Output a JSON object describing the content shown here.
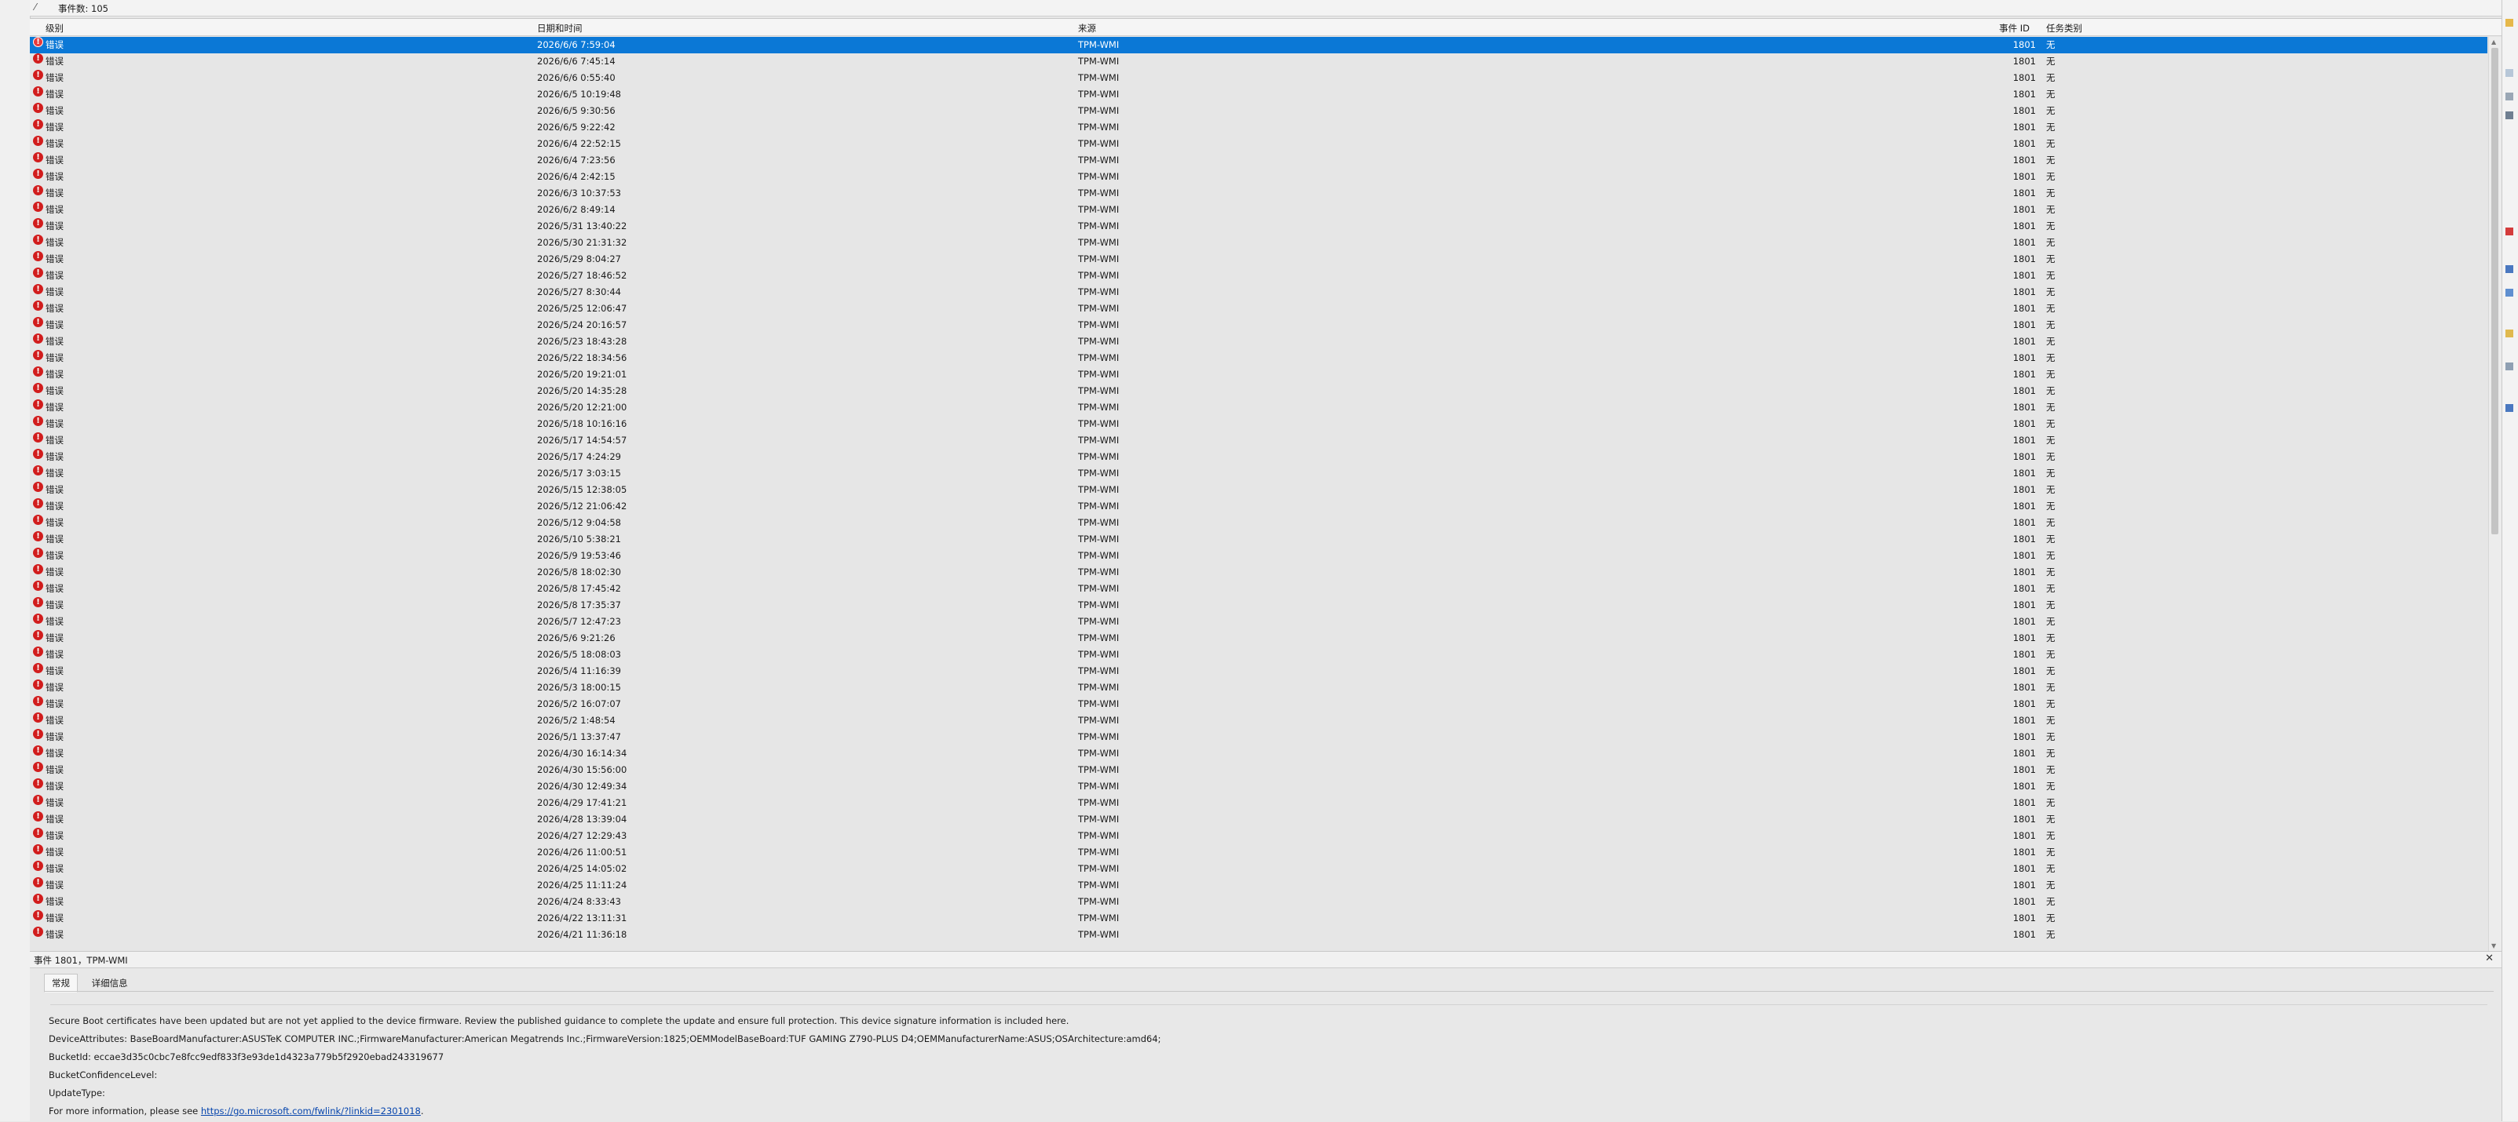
{
  "summary": {
    "label": "事件数: 105"
  },
  "columns": {
    "level": "级别",
    "date": "日期和时间",
    "source": "来源",
    "id": "事件 ID",
    "category": "任务类别"
  },
  "rows": [
    {
      "level": "错误",
      "date": "2026/6/6 7:59:04",
      "source": "TPM-WMI",
      "id": "1801",
      "category": "无"
    },
    {
      "level": "错误",
      "date": "2026/6/6 7:45:14",
      "source": "TPM-WMI",
      "id": "1801",
      "category": "无"
    },
    {
      "level": "错误",
      "date": "2026/6/6 0:55:40",
      "source": "TPM-WMI",
      "id": "1801",
      "category": "无"
    },
    {
      "level": "错误",
      "date": "2026/6/5 10:19:48",
      "source": "TPM-WMI",
      "id": "1801",
      "category": "无"
    },
    {
      "level": "错误",
      "date": "2026/6/5 9:30:56",
      "source": "TPM-WMI",
      "id": "1801",
      "category": "无"
    },
    {
      "level": "错误",
      "date": "2026/6/5 9:22:42",
      "source": "TPM-WMI",
      "id": "1801",
      "category": "无"
    },
    {
      "level": "错误",
      "date": "2026/6/4 22:52:15",
      "source": "TPM-WMI",
      "id": "1801",
      "category": "无"
    },
    {
      "level": "错误",
      "date": "2026/6/4 7:23:56",
      "source": "TPM-WMI",
      "id": "1801",
      "category": "无"
    },
    {
      "level": "错误",
      "date": "2026/6/4 2:42:15",
      "source": "TPM-WMI",
      "id": "1801",
      "category": "无"
    },
    {
      "level": "错误",
      "date": "2026/6/3 10:37:53",
      "source": "TPM-WMI",
      "id": "1801",
      "category": "无"
    },
    {
      "level": "错误",
      "date": "2026/6/2 8:49:14",
      "source": "TPM-WMI",
      "id": "1801",
      "category": "无"
    },
    {
      "level": "错误",
      "date": "2026/5/31 13:40:22",
      "source": "TPM-WMI",
      "id": "1801",
      "category": "无"
    },
    {
      "level": "错误",
      "date": "2026/5/30 21:31:32",
      "source": "TPM-WMI",
      "id": "1801",
      "category": "无"
    },
    {
      "level": "错误",
      "date": "2026/5/29 8:04:27",
      "source": "TPM-WMI",
      "id": "1801",
      "category": "无"
    },
    {
      "level": "错误",
      "date": "2026/5/27 18:46:52",
      "source": "TPM-WMI",
      "id": "1801",
      "category": "无"
    },
    {
      "level": "错误",
      "date": "2026/5/27 8:30:44",
      "source": "TPM-WMI",
      "id": "1801",
      "category": "无"
    },
    {
      "level": "错误",
      "date": "2026/5/25 12:06:47",
      "source": "TPM-WMI",
      "id": "1801",
      "category": "无"
    },
    {
      "level": "错误",
      "date": "2026/5/24 20:16:57",
      "source": "TPM-WMI",
      "id": "1801",
      "category": "无"
    },
    {
      "level": "错误",
      "date": "2026/5/23 18:43:28",
      "source": "TPM-WMI",
      "id": "1801",
      "category": "无"
    },
    {
      "level": "错误",
      "date": "2026/5/22 18:34:56",
      "source": "TPM-WMI",
      "id": "1801",
      "category": "无"
    },
    {
      "level": "错误",
      "date": "2026/5/20 19:21:01",
      "source": "TPM-WMI",
      "id": "1801",
      "category": "无"
    },
    {
      "level": "错误",
      "date": "2026/5/20 14:35:28",
      "source": "TPM-WMI",
      "id": "1801",
      "category": "无"
    },
    {
      "level": "错误",
      "date": "2026/5/20 12:21:00",
      "source": "TPM-WMI",
      "id": "1801",
      "category": "无"
    },
    {
      "level": "错误",
      "date": "2026/5/18 10:16:16",
      "source": "TPM-WMI",
      "id": "1801",
      "category": "无"
    },
    {
      "level": "错误",
      "date": "2026/5/17 14:54:57",
      "source": "TPM-WMI",
      "id": "1801",
      "category": "无"
    },
    {
      "level": "错误",
      "date": "2026/5/17 4:24:29",
      "source": "TPM-WMI",
      "id": "1801",
      "category": "无"
    },
    {
      "level": "错误",
      "date": "2026/5/17 3:03:15",
      "source": "TPM-WMI",
      "id": "1801",
      "category": "无"
    },
    {
      "level": "错误",
      "date": "2026/5/15 12:38:05",
      "source": "TPM-WMI",
      "id": "1801",
      "category": "无"
    },
    {
      "level": "错误",
      "date": "2026/5/12 21:06:42",
      "source": "TPM-WMI",
      "id": "1801",
      "category": "无"
    },
    {
      "level": "错误",
      "date": "2026/5/12 9:04:58",
      "source": "TPM-WMI",
      "id": "1801",
      "category": "无"
    },
    {
      "level": "错误",
      "date": "2026/5/10 5:38:21",
      "source": "TPM-WMI",
      "id": "1801",
      "category": "无"
    },
    {
      "level": "错误",
      "date": "2026/5/9 19:53:46",
      "source": "TPM-WMI",
      "id": "1801",
      "category": "无"
    },
    {
      "level": "错误",
      "date": "2026/5/8 18:02:30",
      "source": "TPM-WMI",
      "id": "1801",
      "category": "无"
    },
    {
      "level": "错误",
      "date": "2026/5/8 17:45:42",
      "source": "TPM-WMI",
      "id": "1801",
      "category": "无"
    },
    {
      "level": "错误",
      "date": "2026/5/8 17:35:37",
      "source": "TPM-WMI",
      "id": "1801",
      "category": "无"
    },
    {
      "level": "错误",
      "date": "2026/5/7 12:47:23",
      "source": "TPM-WMI",
      "id": "1801",
      "category": "无"
    },
    {
      "level": "错误",
      "date": "2026/5/6 9:21:26",
      "source": "TPM-WMI",
      "id": "1801",
      "category": "无"
    },
    {
      "level": "错误",
      "date": "2026/5/5 18:08:03",
      "source": "TPM-WMI",
      "id": "1801",
      "category": "无"
    },
    {
      "level": "错误",
      "date": "2026/5/4 11:16:39",
      "source": "TPM-WMI",
      "id": "1801",
      "category": "无"
    },
    {
      "level": "错误",
      "date": "2026/5/3 18:00:15",
      "source": "TPM-WMI",
      "id": "1801",
      "category": "无"
    },
    {
      "level": "错误",
      "date": "2026/5/2 16:07:07",
      "source": "TPM-WMI",
      "id": "1801",
      "category": "无"
    },
    {
      "level": "错误",
      "date": "2026/5/2 1:48:54",
      "source": "TPM-WMI",
      "id": "1801",
      "category": "无"
    },
    {
      "level": "错误",
      "date": "2026/5/1 13:37:47",
      "source": "TPM-WMI",
      "id": "1801",
      "category": "无"
    },
    {
      "level": "错误",
      "date": "2026/4/30 16:14:34",
      "source": "TPM-WMI",
      "id": "1801",
      "category": "无"
    },
    {
      "level": "错误",
      "date": "2026/4/30 15:56:00",
      "source": "TPM-WMI",
      "id": "1801",
      "category": "无"
    },
    {
      "level": "错误",
      "date": "2026/4/30 12:49:34",
      "source": "TPM-WMI",
      "id": "1801",
      "category": "无"
    },
    {
      "level": "错误",
      "date": "2026/4/29 17:41:21",
      "source": "TPM-WMI",
      "id": "1801",
      "category": "无"
    },
    {
      "level": "错误",
      "date": "2026/4/28 13:39:04",
      "source": "TPM-WMI",
      "id": "1801",
      "category": "无"
    },
    {
      "level": "错误",
      "date": "2026/4/27 12:29:43",
      "source": "TPM-WMI",
      "id": "1801",
      "category": "无"
    },
    {
      "level": "错误",
      "date": "2026/4/26 11:00:51",
      "source": "TPM-WMI",
      "id": "1801",
      "category": "无"
    },
    {
      "level": "错误",
      "date": "2026/4/25 14:05:02",
      "source": "TPM-WMI",
      "id": "1801",
      "category": "无"
    },
    {
      "level": "错误",
      "date": "2026/4/25 11:11:24",
      "source": "TPM-WMI",
      "id": "1801",
      "category": "无"
    },
    {
      "level": "错误",
      "date": "2026/4/24 8:33:43",
      "source": "TPM-WMI",
      "id": "1801",
      "category": "无"
    },
    {
      "level": "错误",
      "date": "2026/4/22 13:11:31",
      "source": "TPM-WMI",
      "id": "1801",
      "category": "无"
    },
    {
      "level": "错误",
      "date": "2026/4/21 11:36:18",
      "source": "TPM-WMI",
      "id": "1801",
      "category": "无"
    }
  ],
  "detail": {
    "title": "事件 1801，TPM-WMI",
    "close_icon": "✕",
    "tabs": [
      "常规",
      "详细信息"
    ],
    "lines": {
      "summary": "Secure Boot certificates have been updated but are not yet applied to the device firmware. Review the published guidance to complete the update and ensure full protection. This device signature information is included here.",
      "device_attributes": "DeviceAttributes: BaseBoardManufacturer:ASUSTeK COMPUTER INC.;FirmwareManufacturer:American Megatrends Inc.;FirmwareVersion:1825;OEMModelBaseBoard:TUF GAMING Z790-PLUS D4;OEMManufacturerName:ASUS;OSArchitecture:amd64;",
      "bucket_id": "BucketId: eccae3d35c0cbc7e8fcc9edf833f3e93de1d4323a779b5f2920ebad243319677",
      "bucket_confidence": "BucketConfidenceLevel:",
      "update_type": "UpdateType:",
      "more_info_prefix": "For more information, please see ",
      "link": "https://go.microsoft.com/fwlink/?linkid=2301018",
      "more_info_suffix": "."
    }
  },
  "colors": {
    "selection": "#0b78d6",
    "error_icon": "#d11d1d",
    "link": "#0645ad"
  }
}
